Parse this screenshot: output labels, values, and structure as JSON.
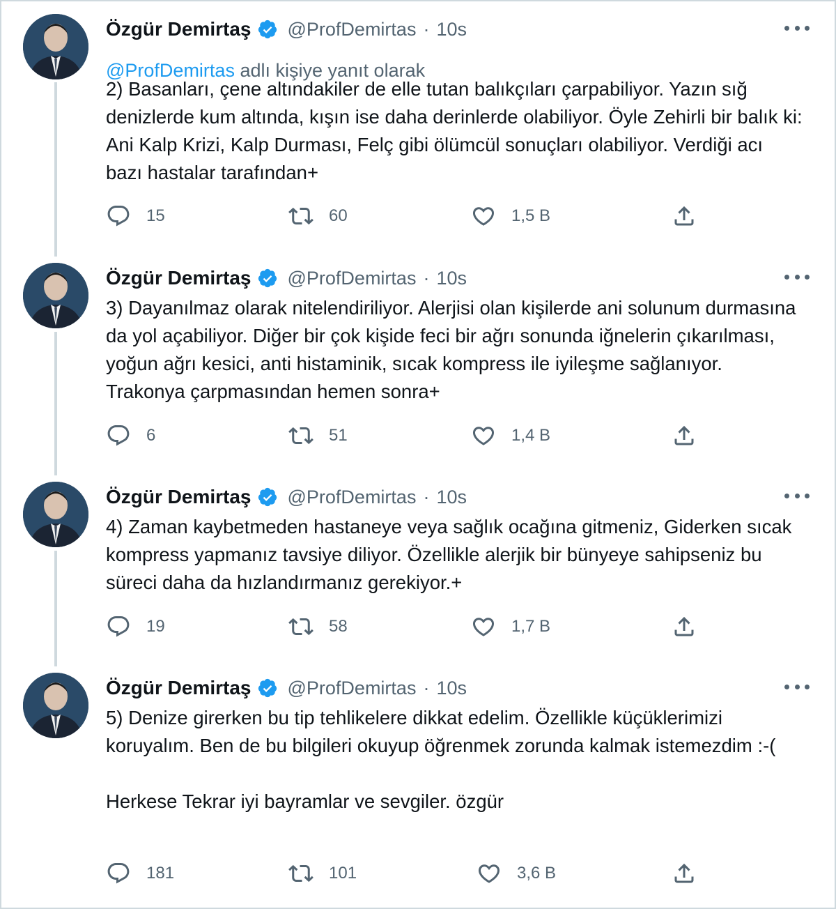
{
  "author": {
    "name": "Özgür Demirtaş",
    "handle": "@ProfDemirtas",
    "separator": "·"
  },
  "tweets": [
    {
      "time": "10s",
      "reply_mention": "@ProfDemirtas",
      "reply_suffix": "adlı kişiye yanıt olarak",
      "text": "2) Basanları, çene altındakiler de elle tutan balıkçıları çarpabiliyor. Yazın sığ denizlerde kum altında, kışın ise daha derinlerde olabiliyor. Öyle Zehirli bir balık ki: Ani Kalp Krizi, Kalp Durması, Felç gibi ölümcül sonuçları olabiliyor. Verdiği acı bazı hastalar tarafından+",
      "replies": "15",
      "retweets": "60",
      "likes": "1,5 B"
    },
    {
      "time": "10s",
      "text": "3) Dayanılmaz olarak nitelendiriliyor. Alerjisi olan kişilerde ani solunum durmasına da yol açabiliyor. Diğer bir çok kişide feci bir ağrı sonunda iğnelerin çıkarılması, yoğun ağrı kesici, anti histaminik, sıcak kompress ile iyileşme sağlanıyor. Trakonya çarpmasından hemen sonra+",
      "replies": "6",
      "retweets": "51",
      "likes": "1,4 B"
    },
    {
      "time": "10s",
      "text": "4) Zaman kaybetmeden hastaneye veya sağlık ocağına gitmeniz, Giderken sıcak kompress yapmanız tavsiye diliyor. Özellikle alerjik bir bünyeye sahipseniz bu süreci daha da hızlandırmanız gerekiyor.+",
      "replies": "19",
      "retweets": "58",
      "likes": "1,7 B"
    },
    {
      "time": "10s",
      "text": "5) Denize girerken bu tip tehlikelere dikkat edelim. Özellikle küçüklerimizi koruyalım. Ben de bu bilgileri okuyup öğrenmek zorunda kalmak istemezdim :-(",
      "text2": "Herkese Tekrar iyi bayramlar ve sevgiler. özgür",
      "replies": "181",
      "retweets": "101",
      "likes": "3,6 B"
    }
  ],
  "icons": {
    "reply": "reply-icon",
    "retweet": "retweet-icon",
    "like": "heart-icon",
    "share": "share-icon",
    "verified": "verified-badge-icon",
    "more": "more-icon"
  },
  "colors": {
    "text": "#0f1419",
    "secondary": "#536471",
    "link": "#1d9bf0",
    "verified": "#1d9bf0",
    "thread_line": "#cfd9de"
  }
}
